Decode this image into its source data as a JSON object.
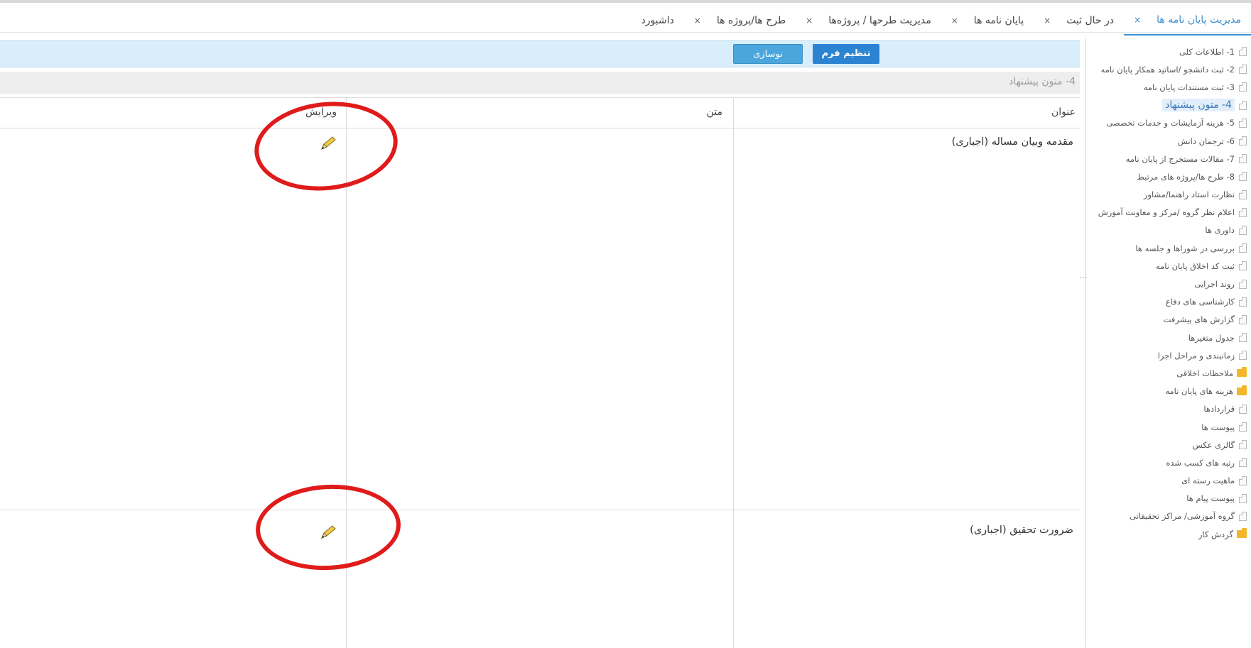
{
  "tabs": [
    {
      "label": "داشبورد",
      "active": false
    },
    {
      "label": "طرح ها/پروژه ها",
      "active": false
    },
    {
      "label": "مدیریت طرحها / پروژه‌ها",
      "active": false
    },
    {
      "label": "پایان نامه ها",
      "active": false
    },
    {
      "label": "در حال ثبت",
      "active": false
    },
    {
      "label": "مدیریت پایان نامه ها",
      "active": true
    }
  ],
  "tab_close_glyph": "×",
  "toolbar": {
    "form_settings_label": "تنظیم فرم",
    "refresh_label": "نوسازی"
  },
  "section": {
    "title": "4- متون پیشنهاد"
  },
  "table": {
    "headers": {
      "title": "عنوان",
      "text": "متن",
      "edit": "ویرایش"
    },
    "rows": [
      {
        "title": "مقدمه وبیان مساله (اجباری)",
        "text": ""
      },
      {
        "title": "ضرورت تحقیق (اجباری)",
        "text": ""
      }
    ]
  },
  "sidebar": {
    "items": [
      {
        "label": "1- اطلاعات کلی",
        "icon": "document-icon"
      },
      {
        "label": "2- ثبت دانشجو /اساتید همکار پایان نامه",
        "icon": "document-icon"
      },
      {
        "label": "3- ثبت مستندات پایان نامه",
        "icon": "document-icon"
      },
      {
        "label": "4- متون پیشنهاد",
        "icon": "document-icon",
        "selected": true
      },
      {
        "label": "5- هزینه آزمایشات و خدمات تخصصی",
        "icon": "document-icon"
      },
      {
        "label": "6- ترجمان دانش",
        "icon": "document-icon"
      },
      {
        "label": "7- مقالات مستخرج از پایان نامه",
        "icon": "document-icon"
      },
      {
        "label": "8- طرح ها/پروژه های مرتبط",
        "icon": "document-icon"
      },
      {
        "label": "نظارت استاد راهنما/مشاور",
        "icon": "document-icon"
      },
      {
        "label": "اعلام نظر گروه /مرکز و معاونت آموزش",
        "icon": "document-icon"
      },
      {
        "label": "داوری ها",
        "icon": "document-icon"
      },
      {
        "label": "بررسی در شوراها و جلسه ها",
        "icon": "document-icon"
      },
      {
        "label": "ثبت کد اخلاق پایان نامه",
        "icon": "document-icon"
      },
      {
        "label": "روند اجرایی",
        "icon": "document-icon"
      },
      {
        "label": "کارشناسی های دفاع",
        "icon": "document-icon"
      },
      {
        "label": "گزارش های پیشرفت",
        "icon": "document-icon"
      },
      {
        "label": "جدول متغیرها",
        "icon": "document-icon"
      },
      {
        "label": "زمانبندی و مراحل اجرا",
        "icon": "document-icon"
      },
      {
        "label": "ملاحظات اخلاقی",
        "icon": "folder-icon"
      },
      {
        "label": "هزینه های پایان نامه",
        "icon": "folder-icon"
      },
      {
        "label": "قراردادها",
        "icon": "document-icon"
      },
      {
        "label": "پیوست ها",
        "icon": "document-icon"
      },
      {
        "label": "گالری عکس",
        "icon": "document-icon"
      },
      {
        "label": "رتبه های کسب شده",
        "icon": "document-icon"
      },
      {
        "label": "ماهیت رسته ای",
        "icon": "document-icon"
      },
      {
        "label": "پیوست پیام ها",
        "icon": "document-icon"
      },
      {
        "label": "گروه آموزشی/ مراکز تحقیقاتی",
        "icon": "document-icon"
      },
      {
        "label": "گردش کار",
        "icon": "folder-icon"
      }
    ]
  },
  "colors": {
    "accent": "#3a8fd0",
    "toolbar_bg": "#d8eefa",
    "primary_button": "#2b84d2",
    "annotation": "#e01b1b",
    "folder": "#f2b72b"
  }
}
